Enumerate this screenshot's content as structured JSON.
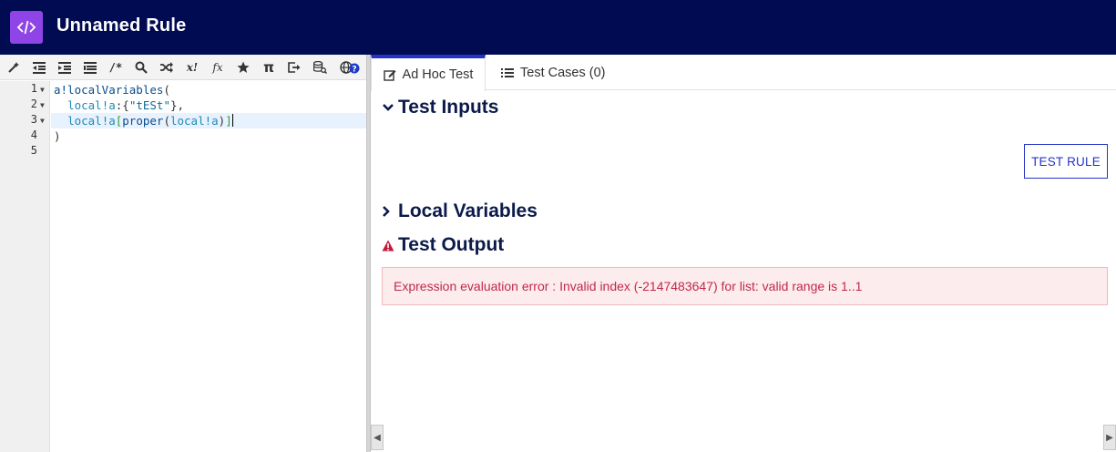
{
  "header": {
    "title": "Unnamed Rule",
    "logo_icon": "code-brackets-icon",
    "bg": "#000b52",
    "logo_bg": "#8e44e6"
  },
  "toolbar": {
    "buttons": [
      "format-icon",
      "outdent-icon",
      "indent-icon",
      "list-icon",
      "comment-icon",
      "search-icon",
      "shuffle-icon",
      "exclamation-icon",
      "function-icon",
      "star-icon",
      "pi-icon",
      "export-icon",
      "database-search-icon",
      "globe-help-icon"
    ],
    "comment_label": "/*",
    "x_label": "x!",
    "fx_label": "fx",
    "pi_label": "π"
  },
  "editor": {
    "line_numbers": [
      "1",
      "2",
      "3",
      "4",
      "5"
    ],
    "lines": {
      "l1": {
        "fn": "a!localVariables",
        "p": "("
      },
      "l2": {
        "var": "local!a",
        "p1": ":{",
        "str": "\"tESt\"",
        "p2": "},"
      },
      "l3": {
        "var": "local!a",
        "b1": "[",
        "fn": "proper",
        "p1": "(",
        "var2": "local!a",
        "p2": ")",
        "b2": "]"
      },
      "l4": {
        "p": ")"
      }
    }
  },
  "tabs": [
    {
      "label": "Ad Hoc Test",
      "icon": "edit-icon"
    },
    {
      "label": "Test Cases (0)",
      "icon": "list-icon"
    }
  ],
  "sections": {
    "test_inputs": "Test Inputs",
    "local_variables": "Local Variables",
    "test_output": "Test Output"
  },
  "test_button": "TEST RULE",
  "error": {
    "message": "Expression evaluation error : Invalid index (-2147483647) for list: valid range is 1..1",
    "color": "#c0284a"
  }
}
